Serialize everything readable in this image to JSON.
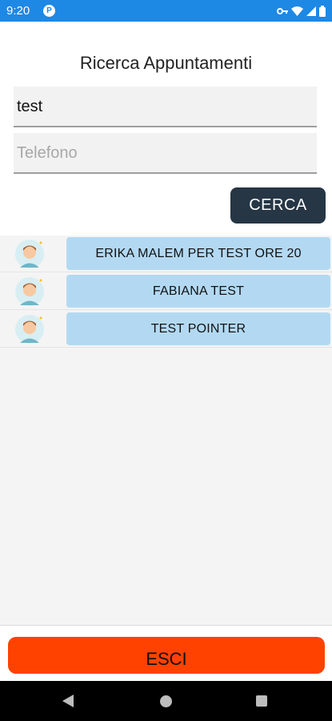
{
  "status_bar": {
    "time": "9:20"
  },
  "page": {
    "title": "Ricerca Appuntamenti"
  },
  "form": {
    "name_value": "test",
    "phone_placeholder": "Telefono",
    "search_label": "CERCA"
  },
  "results": [
    {
      "label": "ERIKA MALEM PER TEST ORE 20",
      "icon": "avatar-icon"
    },
    {
      "label": "FABIANA TEST",
      "icon": "avatar-icon"
    },
    {
      "label": "TEST POINTER",
      "icon": "avatar-icon"
    }
  ],
  "footer": {
    "exit_label": "ESCI"
  },
  "colors": {
    "status_bar": "#1e88e5",
    "search_button": "#263645",
    "result_button": "#b3d9f2",
    "exit_button": "#ff4200"
  }
}
